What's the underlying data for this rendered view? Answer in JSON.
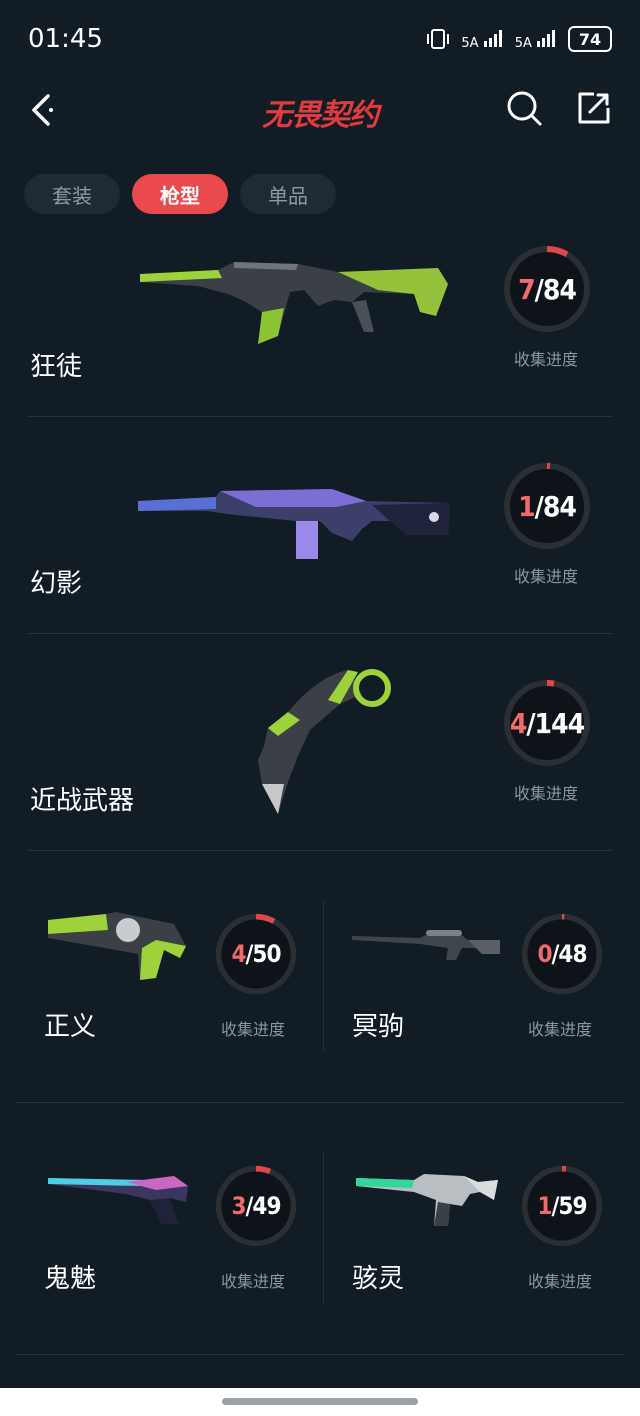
{
  "status": {
    "time": "01:45",
    "signal1": "5A",
    "signal2": "5A",
    "battery": "74"
  },
  "header": {
    "title": "无畏契约"
  },
  "tabs": [
    {
      "label": "套装",
      "active": false
    },
    {
      "label": "枪型",
      "active": true
    },
    {
      "label": "单品",
      "active": false
    }
  ],
  "rows": [
    {
      "name": "狂徒",
      "current": "7",
      "total": "/84",
      "label": "收集进度",
      "progress": 0.0833
    },
    {
      "name": "幻影",
      "current": "1",
      "total": "/84",
      "label": "收集进度",
      "progress": 0.0119
    },
    {
      "name": "近战武器",
      "current": "4",
      "total": "/144",
      "label": "收集进度",
      "progress": 0.0278
    }
  ],
  "cells": [
    {
      "name": "正义",
      "current": "4",
      "total": "/50",
      "label": "收集进度",
      "progress": 0.08
    },
    {
      "name": "冥驹",
      "current": "0",
      "total": "/48",
      "label": "收集进度",
      "progress": 0.0
    },
    {
      "name": "鬼魅",
      "current": "3",
      "total": "/49",
      "label": "收集进度",
      "progress": 0.0612
    },
    {
      "name": "骇灵",
      "current": "1",
      "total": "/59",
      "label": "收集进度",
      "progress": 0.0169
    }
  ],
  "colors": {
    "accent": "#ea4a4e",
    "ring_track": "#2a2f33",
    "ring_progress": "#e0474b"
  }
}
